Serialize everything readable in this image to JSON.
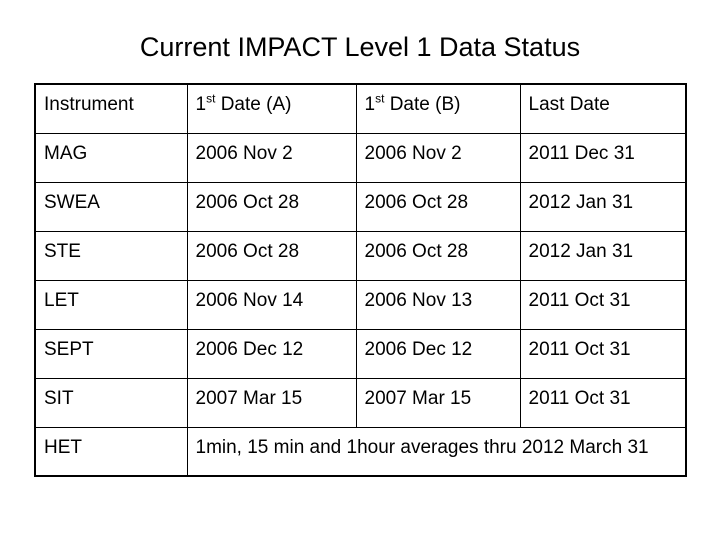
{
  "slide": {
    "title": "Current IMPACT Level 1 Data Status"
  },
  "table": {
    "headers": {
      "instrument": "Instrument",
      "date_a_prefix": "1",
      "date_a_sup": "st",
      "date_a_suffix": " Date (A)",
      "date_b_prefix": "1",
      "date_b_sup": "st",
      "date_b_suffix": " Date (B)",
      "last_date": "Last Date"
    },
    "rows": [
      {
        "instrument": "MAG",
        "date_a": "2006 Nov 2",
        "date_b": "2006 Nov 2",
        "last_date": "2011 Dec 31"
      },
      {
        "instrument": "SWEA",
        "date_a": "2006 Oct 28",
        "date_b": "2006 Oct 28",
        "last_date": "2012 Jan 31"
      },
      {
        "instrument": "STE",
        "date_a": "2006 Oct 28",
        "date_b": "2006 Oct 28",
        "last_date": "2012 Jan 31"
      },
      {
        "instrument": "LET",
        "date_a": "2006 Nov 14",
        "date_b": "2006 Nov 13",
        "last_date": "2011 Oct 31"
      },
      {
        "instrument": "SEPT",
        "date_a": "2006 Dec 12",
        "date_b": "2006 Dec 12",
        "last_date": "2011 Oct 31"
      },
      {
        "instrument": "SIT",
        "date_a": "2007 Mar 15",
        "date_b": "2007 Mar 15",
        "last_date": "2011 Oct 31"
      }
    ],
    "het_row": {
      "instrument": "HET",
      "note": "1min, 15 min and 1hour averages thru 2012 March 31"
    }
  },
  "colors": {
    "text": "#000000",
    "border": "#000000",
    "background": "#ffffff"
  }
}
